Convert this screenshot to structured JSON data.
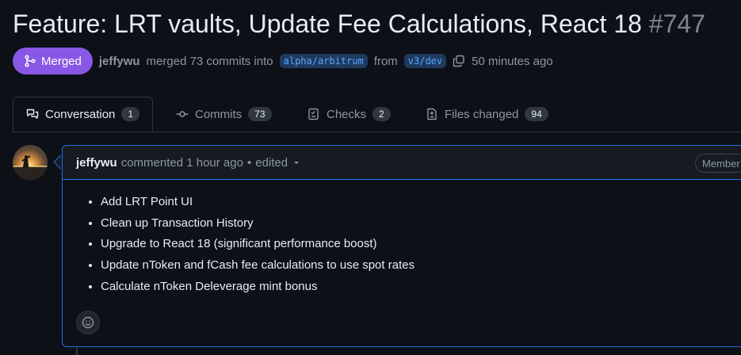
{
  "pr": {
    "title": "Feature: LRT vaults, Update Fee Calculations, React 18",
    "number": "#747",
    "status": "Merged",
    "author": "jeffywu",
    "merge_text": "merged 73 commits into",
    "base_branch": "alpha/arbitrum",
    "from_text": "from",
    "head_branch": "v3/dev",
    "time": "50 minutes ago"
  },
  "tabs": [
    {
      "label": "Conversation",
      "count": "1",
      "icon": "conversation-icon"
    },
    {
      "label": "Commits",
      "count": "73",
      "icon": "commit-icon"
    },
    {
      "label": "Checks",
      "count": "2",
      "icon": "checks-icon"
    },
    {
      "label": "Files changed",
      "count": "94",
      "icon": "file-diff-icon"
    }
  ],
  "comment": {
    "author": "jeffywu",
    "action": "commented 1 hour ago",
    "separator": "•",
    "edited": "edited",
    "role_badge": "Member",
    "items": [
      "Add LRT Point UI",
      "Clean up Transaction History",
      "Upgrade to React 18 (significant performance boost)",
      "Update nToken and fCash fee calculations to use spot rates",
      "Calculate nToken Deleverage mint bonus"
    ]
  },
  "colors": {
    "background": "#0d1117",
    "merged_badge": "#8957e5",
    "branch_text": "#58a6ff",
    "focus_border": "#1f6feb"
  }
}
